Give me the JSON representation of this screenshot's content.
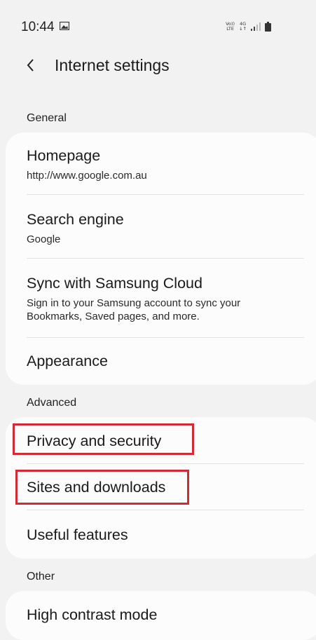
{
  "status_bar": {
    "time": "10:44",
    "volte_top": "Vo))",
    "volte_bottom": "LTE",
    "network_top": "4G",
    "network_bottom": "↓↑",
    "icons": [
      "gallery-icon",
      "signal-icon",
      "battery-icon"
    ]
  },
  "header": {
    "title": "Internet settings",
    "back_icon": "chevron-left-icon"
  },
  "sections": {
    "general": {
      "label": "General",
      "homepage": {
        "title": "Homepage",
        "subtitle": "http://www.google.com.au"
      },
      "search_engine": {
        "title": "Search engine",
        "subtitle": "Google"
      },
      "sync": {
        "title": "Sync with Samsung Cloud",
        "subtitle_line1": "Sign in to your Samsung account to sync your",
        "subtitle_line2": "Bookmarks, Saved pages, and more."
      },
      "appearance": {
        "title": "Appearance"
      }
    },
    "advanced": {
      "label": "Advanced",
      "privacy": {
        "title": "Privacy and security"
      },
      "sites": {
        "title": "Sites and downloads"
      },
      "useful": {
        "title": "Useful features"
      }
    },
    "other": {
      "label": "Other",
      "high_contrast": {
        "title": "High contrast mode"
      }
    }
  },
  "colors": {
    "highlight": "#d42a35",
    "background": "#f2f2f2",
    "card": "#fcfcfc"
  }
}
